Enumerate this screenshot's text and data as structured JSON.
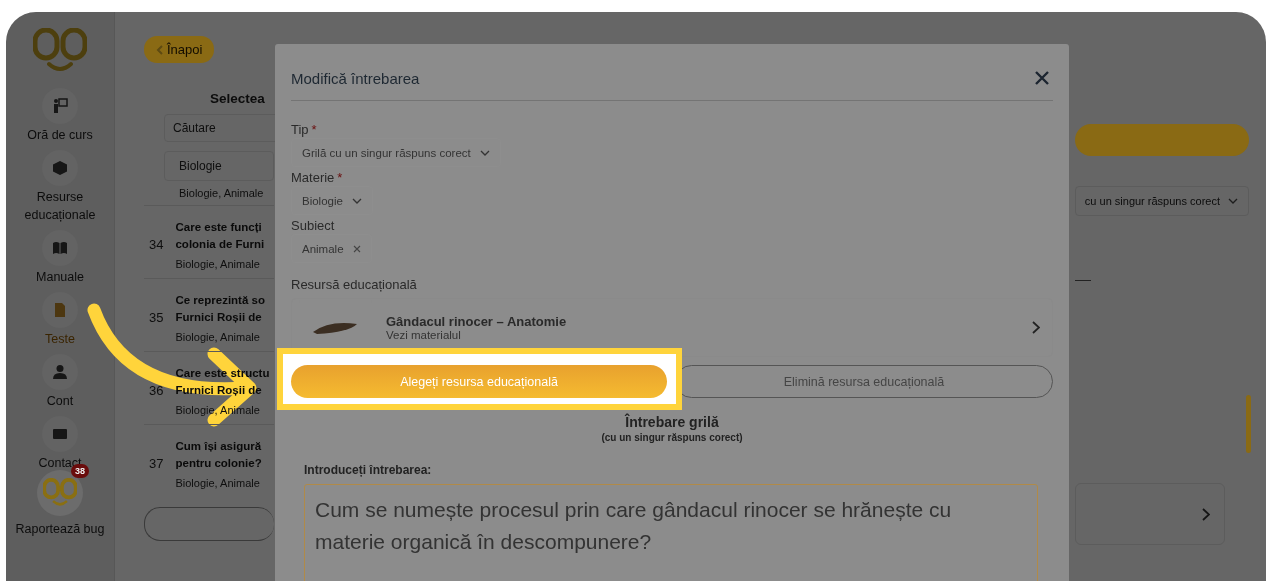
{
  "sidebar": {
    "items": [
      {
        "label": "Oră de curs",
        "selected": false
      },
      {
        "label": "Resurse educaționale",
        "selected": false
      },
      {
        "label": "Manuale",
        "selected": false
      },
      {
        "label": "Teste",
        "selected": true
      },
      {
        "label": "Cont",
        "selected": false
      },
      {
        "label": "Contact",
        "selected": false
      }
    ],
    "bug_report": {
      "badge": "38",
      "label": "Raportează bug"
    }
  },
  "background": {
    "back_button": "Înapoi",
    "heading": "Selectea",
    "search": {
      "placeholder": "Căutare"
    },
    "filter": "Biologie",
    "partial_meta": "Biologie, Animale",
    "questions": [
      {
        "number": "34",
        "lines": [
          "Care este funcți",
          "colonia de Furni"
        ],
        "meta": "Biologie, Animale"
      },
      {
        "number": "35",
        "lines": [
          "Ce reprezintă so",
          "Furnici Roșii de"
        ],
        "meta": "Biologie, Animale"
      },
      {
        "number": "36",
        "lines": [
          "Care este structu",
          "Furnici Roșii de"
        ],
        "meta": "Biologie, Animale"
      },
      {
        "number": "37",
        "lines": [
          "Cum își asigură",
          "pentru colonie?"
        ],
        "meta": "Biologie, Animale"
      }
    ],
    "type_dropdown": "cu un singur răspuns corect"
  },
  "modal": {
    "title": "Modifică întrebarea",
    "fields": [
      {
        "label": "Tip",
        "required_mark": "*",
        "kind": "dropdown",
        "value": "Grilă cu un singur răspuns corect"
      },
      {
        "label": "Materie",
        "required_mark": "*",
        "kind": "dropdown",
        "value": "Biologie"
      },
      {
        "label": "Subiect",
        "kind": "chip",
        "value": "Animale"
      }
    ],
    "resource": {
      "label": "Resursă educațională",
      "title": "Gândacul rinocer – Anatomie",
      "link": "Vezi materialul"
    },
    "choose_button": "Alegeți resursa educațională",
    "remove_button": "Elimină resursa educațională",
    "question_heading": "Întrebare grilă",
    "question_subheading": "(cu un singur răspuns corect)",
    "question_label": "Introduceți întrebarea:",
    "question_value": "Cum se numește procesul prin care gândacul rinocer se hrănește cu materie organică în descompunere?"
  }
}
